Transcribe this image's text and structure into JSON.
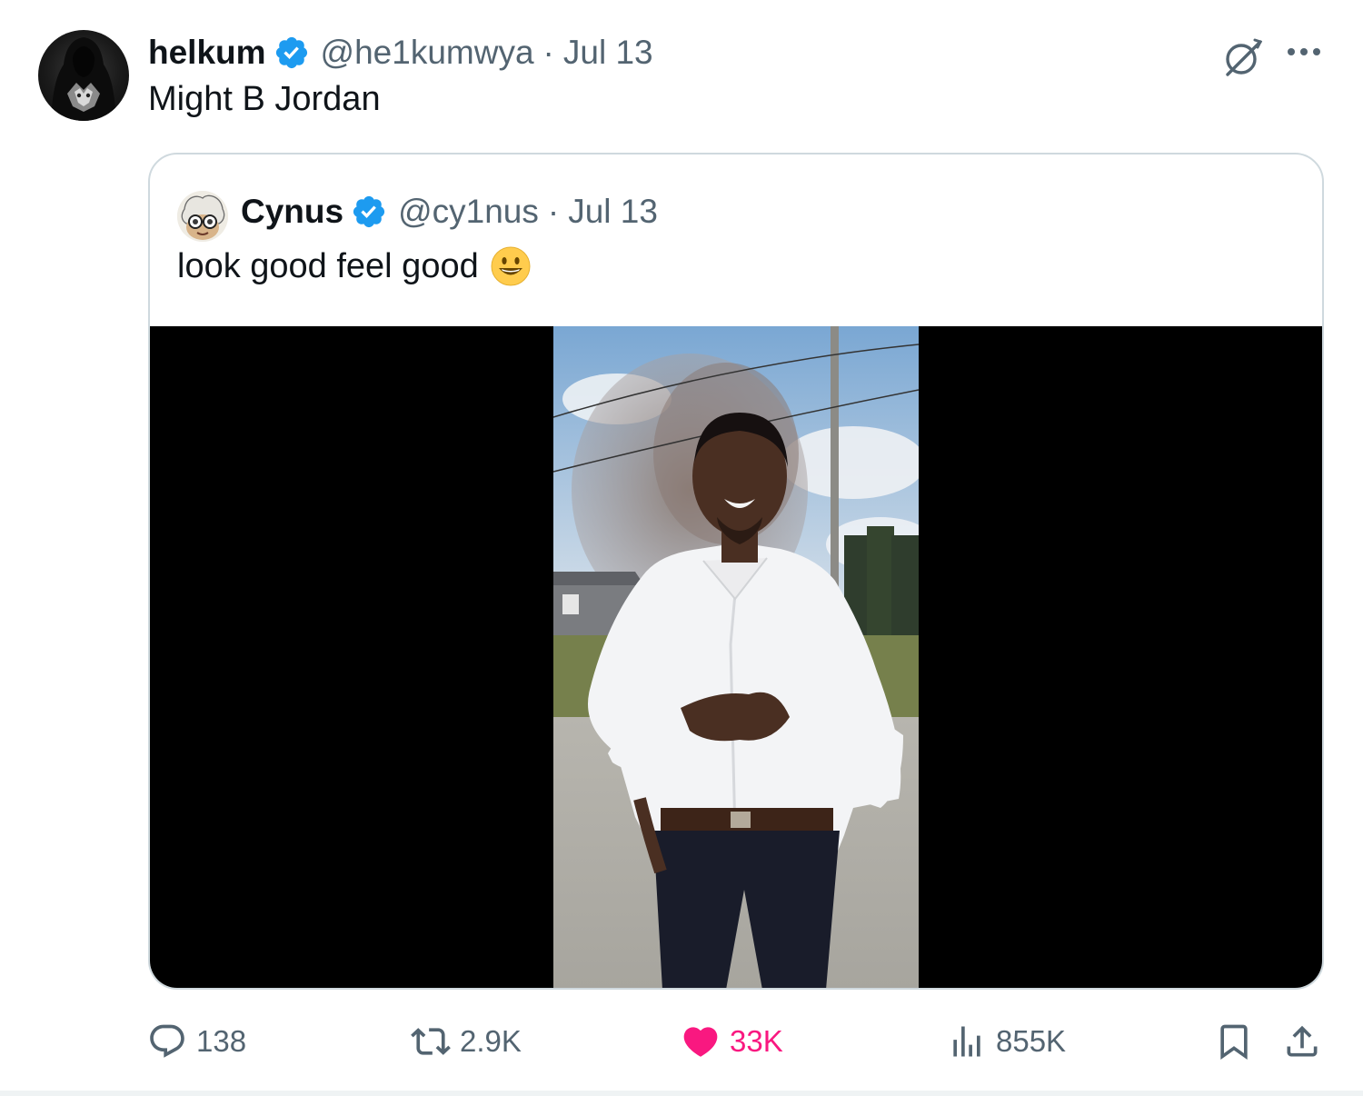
{
  "tweet": {
    "author": {
      "display_name": "helkum",
      "handle": "@he1kumwya",
      "verified": true
    },
    "separator": "·",
    "date": "Jul 13",
    "text": "Might B Jordan",
    "quoted": {
      "author": {
        "display_name": "Cynus",
        "handle": "@cy1nus",
        "verified": true
      },
      "separator": "·",
      "date": "Jul 13",
      "text": "look good feel good",
      "emoji": "grinning-face"
    },
    "stats": {
      "replies": "138",
      "reposts": "2.9K",
      "likes": "33K",
      "views": "855K"
    }
  },
  "colors": {
    "text_primary": "#0f1419",
    "text_secondary": "#536471",
    "verified_blue": "#1d9bf0",
    "like_pink": "#f91880",
    "border": "#cfd9de"
  },
  "icons": {
    "verified": "verified-badge-icon",
    "grok": "grok-icon",
    "more": "more-icon",
    "reply": "reply-icon",
    "repost": "repost-icon",
    "like": "heart-icon",
    "views": "views-chart-icon",
    "bookmark": "bookmark-icon",
    "share": "share-icon"
  }
}
